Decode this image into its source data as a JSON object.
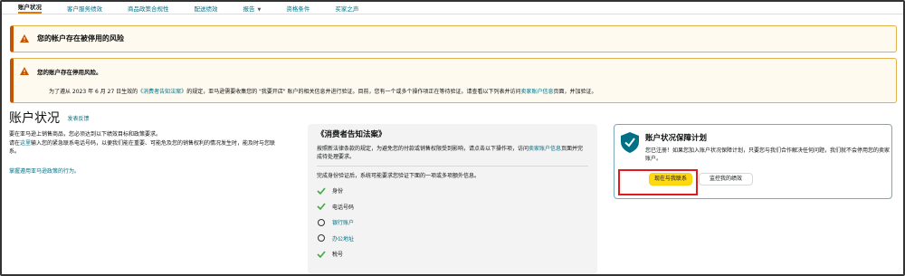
{
  "nav": {
    "items": [
      {
        "label": "账户状况",
        "caret": false
      },
      {
        "label": "客户服务绩效",
        "caret": false
      },
      {
        "label": "商品政策合规性",
        "caret": false
      },
      {
        "label": "配送绩效",
        "caret": false
      },
      {
        "label": "报告",
        "caret": true
      },
      {
        "label": "资格条件",
        "caret": false
      },
      {
        "label": "买家之声",
        "caret": false
      }
    ]
  },
  "alerts": {
    "suspension_risk": "您的帐户存在被停用的风险",
    "deactivation_title": "您的账户存在停用风险。",
    "deactivation_body": {
      "part1": "为了遵从 2023 年 6 月 27 日生效的",
      "link1": "《消费者告知法案》",
      "part2": "的规定，亚马逊需要收集您的 \"我要开店\" 账户的相关信息并进行验证。目前，您有一个或多个操作项正在等待验证。请查看以下列表并访问",
      "link2": "卖家账户信息",
      "part3": "页面，并加验证。"
    }
  },
  "left": {
    "title": "账户状况",
    "feedback": "发表反馈",
    "p1": "要在亚马逊上销售商品，您必须达到以下绩效目标和政策要求。",
    "p2_prefix": "请在",
    "p2_link": "这里",
    "p2_suffix": "输入您的紧急联系电话号码，以便我们能在重要、可能危及您的销售权利的情况发生时，能及时与您联系。",
    "more_link": "掌握遵用亚马逊政策的行为。"
  },
  "middle": {
    "title": "《消费者告知法案》",
    "desc_part1": "按照新法律条款的规定，为避免您的付款或销售权限受到影响，请点击以下操作项，访问",
    "desc_link": "卖家账户信息",
    "desc_part2": "页面并完成待处理要求。",
    "intro": "完成身份验证后，系统可能要求您验证下面的一项或多项额外信息。",
    "requirements": [
      {
        "label": "身份",
        "status": "check"
      },
      {
        "label": "电话号码",
        "status": "check"
      },
      {
        "label": "银行账户",
        "status": "pending"
      },
      {
        "label": "办公地址",
        "status": "pending"
      },
      {
        "label": "税号",
        "status": "check"
      }
    ]
  },
  "right": {
    "title": "账户状况保障计划",
    "body": "您已注册！如果您加入账户状况保障计划，只要您与我们合作解决任何问题，我们就不会停用您的卖家账户。",
    "contact_button": "现在与我联系",
    "monitor_button": "监控我的绩效"
  },
  "colors": {
    "accent_orange": "#e77600",
    "link_teal": "#007185",
    "check_green": "#3fa83f",
    "button_yellow": "#ffd814",
    "highlight_red": "#e01b1b"
  }
}
